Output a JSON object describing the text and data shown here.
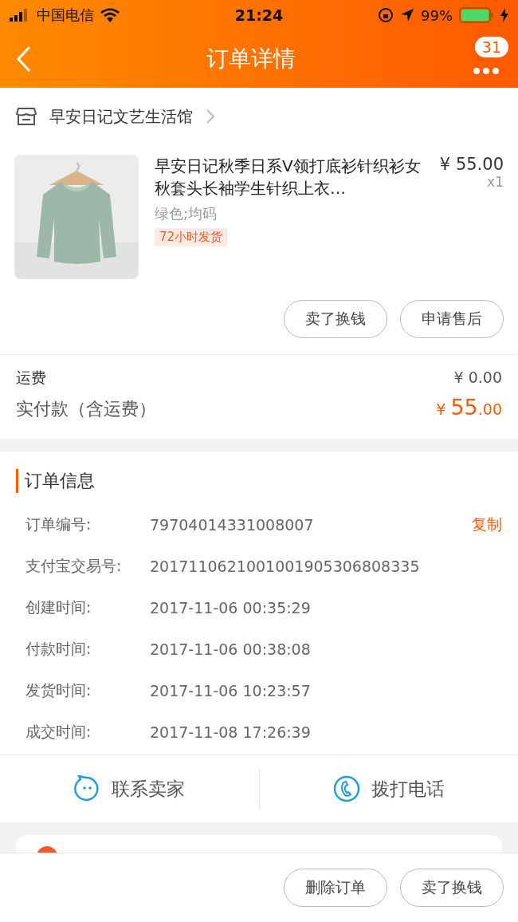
{
  "status_bar": {
    "carrier": "中国电信",
    "time": "21:24",
    "battery": "99%"
  },
  "nav": {
    "title": "订单详情",
    "badge": "31"
  },
  "shop": {
    "name": "早安日记文艺生活馆"
  },
  "product": {
    "title": "早安日记秋季日系V领打底衫针织衫女秋套头长袖学生针织上衣…",
    "price": "¥ 55.00",
    "quantity": "x1",
    "variant": "绿色;均码",
    "tag": "72小时发货"
  },
  "item_actions": [
    "卖了换钱",
    "申请售后"
  ],
  "costs": {
    "shipping_label": "运费",
    "shipping": "¥ 0.00",
    "total_label": "实付款（含运费）",
    "total_currency": "¥",
    "total_int": "55",
    "total_dec": ".00"
  },
  "order_info": {
    "title": "订单信息",
    "copy": "复制",
    "rows": [
      {
        "label": "订单编号:",
        "value": "79704014331008007"
      },
      {
        "label": "支付宝交易号:",
        "value": "2017110621001001905306808335"
      },
      {
        "label": "创建时间:",
        "value": "2017-11-06 00:35:29"
      },
      {
        "label": "付款时间:",
        "value": "2017-11-06 00:38:08"
      },
      {
        "label": "发货时间:",
        "value": "2017-11-06 10:23:57"
      },
      {
        "label": "成交时间:",
        "value": "2017-11-08 17:26:39"
      }
    ]
  },
  "contact": [
    {
      "kind": "chat",
      "label": "联系卖家"
    },
    {
      "kind": "phone",
      "label": "拨打电话"
    }
  ],
  "bottom_actions": [
    "删除订单",
    "卖了换钱"
  ]
}
